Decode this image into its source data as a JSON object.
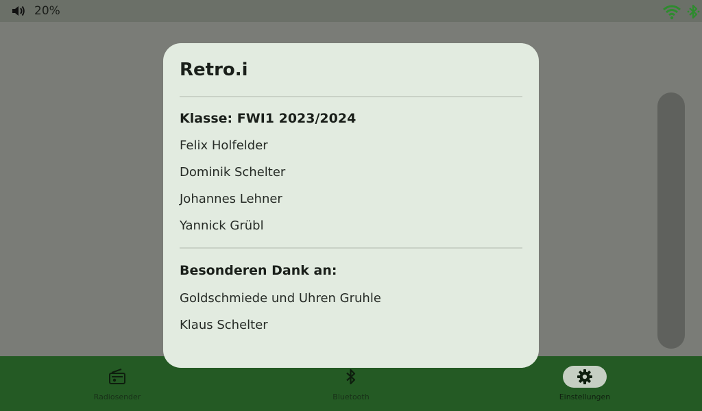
{
  "status_bar": {
    "volume": "20%",
    "icons": [
      "volume-icon",
      "wifi-icon",
      "bluetooth-icon"
    ]
  },
  "dialog": {
    "title": "Retro.i",
    "class_heading": "Klasse: FWI1 2023/2024",
    "members": [
      "Felix Holfelder",
      "Dominik Schelter",
      "Johannes Lehner",
      "Yannick Grübl"
    ],
    "thanks_heading": "Besonderen Dank an:",
    "thanks": [
      "Goldschmiede und Uhren Gruhle",
      "Klaus Schelter"
    ]
  },
  "nav": {
    "items": [
      {
        "label": "Radiosender",
        "icon": "radio-icon"
      },
      {
        "label": "Bluetooth",
        "icon": "bluetooth-icon"
      },
      {
        "label": "Einstellungen",
        "icon": "gear-icon"
      }
    ],
    "active": "Einstellungen"
  },
  "colors": {
    "nav_background": "#245a24",
    "dialog_background": "#e2ebe0",
    "status_icon_green": "#2e8b2e"
  }
}
